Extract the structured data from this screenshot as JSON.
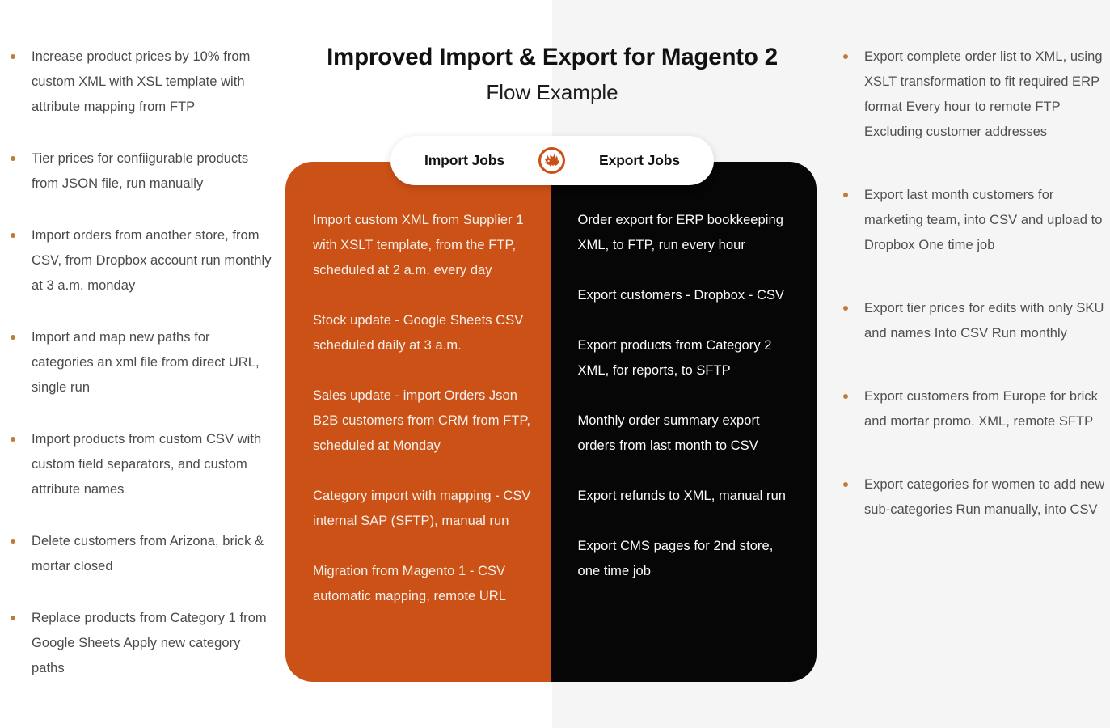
{
  "header": {
    "title": "Improved Import & Export for Magento 2",
    "subtitle": "Flow Example"
  },
  "tabs": {
    "import_label": "Import Jobs",
    "export_label": "Export Jobs",
    "brand_icon": "firebear-bear-logo-icon"
  },
  "colors": {
    "import_panel": "#cc5116",
    "export_panel": "#060606",
    "brand_orange": "#cc5116",
    "bullet_dot": "#c07a3a",
    "background_left": "#ffffff",
    "background_right": "#f5f5f5",
    "body_text": "#4a4a4a",
    "panel_text": "#f6f0ea"
  },
  "import_panel": {
    "jobs": [
      "Import custom XML from Supplier 1 with XSLT template, from the FTP, scheduled at 2 a.m. every day",
      "Stock update - Google Sheets CSV scheduled daily at 3 a.m.",
      "Sales update - import Orders Json B2B customers from CRM from FTP, scheduled at Monday",
      "Category import with mapping - CSV internal SAP (SFTP), manual run",
      "Migration from Magento 1 - CSV automatic mapping, remote URL"
    ]
  },
  "export_panel": {
    "jobs": [
      "Order export for ERP bookkeeping XML, to FTP, run every hour",
      "Export customers - Dropbox - CSV",
      "Export products from Category 2 XML, for reports, to SFTP",
      "Monthly order summary export orders from last month to CSV",
      "Export refunds to XML, manual run",
      "Export CMS pages for 2nd store, one time job"
    ]
  },
  "left_column": {
    "items": [
      "Increase product prices by 10% from custom XML with XSL template with attribute mapping from FTP",
      "Tier prices for confiigurable products from JSON file, run manually",
      "Import orders from another store, from CSV, from Dropbox account run monthly at 3 a.m. monday",
      "Import and map new paths for categories an xml file from direct URL, single run",
      "Import products from custom CSV with custom field separators, and custom attribute names",
      "Delete customers from Arizona, brick & mortar closed",
      "Replace products from Category 1 from Google Sheets Apply new category paths"
    ]
  },
  "right_column": {
    "items": [
      "Export complete order list to XML, using XSLT transformation to fit required ERP format Every hour to remote FTP Excluding customer addresses",
      "Export last month customers for marketing team, into CSV and upload to Dropbox One time job",
      "Export tier prices for edits with only SKU and names Into CSV Run monthly",
      "Export customers from Europe for brick and mortar promo. XML, remote SFTP",
      "Export categories for women to add new sub-categories Run manually, into CSV"
    ]
  }
}
